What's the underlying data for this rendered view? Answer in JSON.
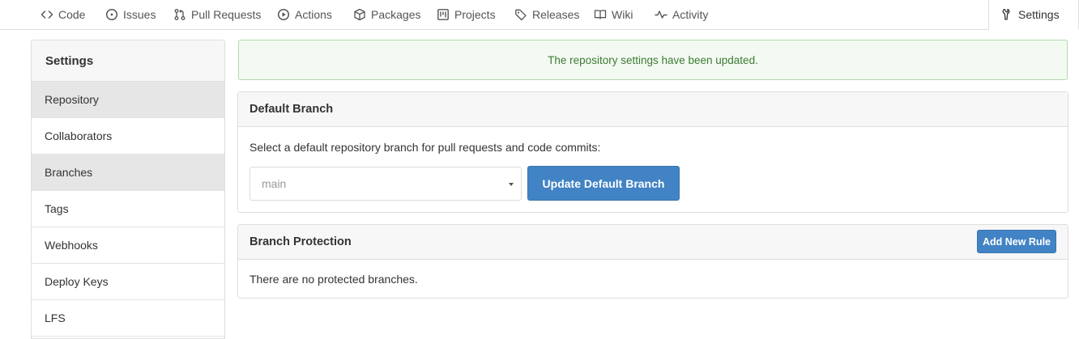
{
  "nav": {
    "tabs": [
      {
        "label": "Code",
        "icon": "code-icon"
      },
      {
        "label": "Issues",
        "icon": "issue-icon"
      },
      {
        "label": "Pull Requests",
        "icon": "pull-request-icon"
      },
      {
        "label": "Actions",
        "icon": "play-icon"
      },
      {
        "label": "Packages",
        "icon": "package-icon"
      },
      {
        "label": "Projects",
        "icon": "project-icon"
      },
      {
        "label": "Releases",
        "icon": "tag-icon"
      },
      {
        "label": "Wiki",
        "icon": "book-icon"
      },
      {
        "label": "Activity",
        "icon": "pulse-icon"
      },
      {
        "label": "Settings",
        "icon": "tools-icon",
        "active": true
      }
    ]
  },
  "sidebar": {
    "title": "Settings",
    "items": [
      {
        "label": "Repository",
        "selected": true
      },
      {
        "label": "Collaborators",
        "selected": false
      },
      {
        "label": "Branches",
        "selected": true
      },
      {
        "label": "Tags",
        "selected": false
      },
      {
        "label": "Webhooks",
        "selected": false
      },
      {
        "label": "Deploy Keys",
        "selected": false
      },
      {
        "label": "LFS",
        "selected": false
      }
    ]
  },
  "alert": {
    "message": "The repository settings have been updated."
  },
  "default_branch": {
    "title": "Default Branch",
    "description": "Select a default repository branch for pull requests and code commits:",
    "selected_branch": "main",
    "button_label": "Update Default Branch"
  },
  "branch_protection": {
    "title": "Branch Protection",
    "button_label": "Add New Rule",
    "empty_message": "There are no protected branches."
  },
  "colors": {
    "primary": "#4183c4",
    "success_bg": "#f3faf2",
    "success_text": "#3d7a35"
  }
}
